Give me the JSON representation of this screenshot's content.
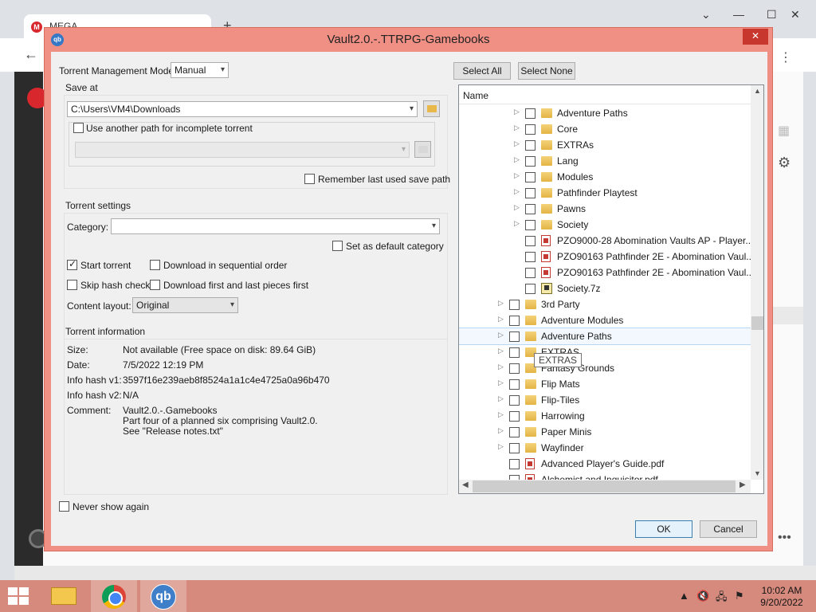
{
  "background": {
    "tab_title": "MEGA",
    "tab_icon_letter": "M"
  },
  "dialog": {
    "title": "Vault2.0.-.TTRPG-Gamebooks",
    "title_icon_text": "qb",
    "close_glyph": "✕",
    "mode_label": "Torrent Management Mode:",
    "mode_value": "Manual",
    "save_at_title": "Save at",
    "save_path": "C:\\Users\\VM4\\Downloads",
    "another_path_label": "Use another path for incomplete torrent",
    "remember_label": "Remember last used save path",
    "settings_title": "Torrent settings",
    "category_label": "Category:",
    "category_value": "",
    "default_category_label": "Set as default category",
    "start_torrent_label": "Start torrent",
    "sequential_label": "Download in sequential order",
    "skip_hash_label": "Skip hash check",
    "first_last_label": "Download first and last pieces first",
    "content_layout_label": "Content layout:",
    "content_layout_value": "Original",
    "info_title": "Torrent information",
    "info": {
      "size_label": "Size:",
      "size_value": "Not available (Free space on disk: 89.64 GiB)",
      "date_label": "Date:",
      "date_value": "7/5/2022 12:19 PM",
      "hash1_label": "Info hash v1:",
      "hash1_value": "3597f16e239aeb8f8524a1a1c4e4725a0a96b470",
      "hash2_label": "Info hash v2:",
      "hash2_value": "N/A",
      "comment_label": "Comment:",
      "comment_line1": "Vault2.0.-.Gamebooks",
      "comment_line2": "Part four of a planned six comprising Vault2.0.",
      "comment_line3": "See \"Release notes.txt\""
    },
    "never_show_label": "Never show again",
    "select_all": "Select All",
    "select_none": "Select None",
    "tree_header": "Name",
    "tree_rows": [
      {
        "label": "Adventure Paths",
        "type": "folder",
        "level": 2,
        "expandable": true
      },
      {
        "label": "Core",
        "type": "folder",
        "level": 2,
        "expandable": true
      },
      {
        "label": "EXTRAs",
        "type": "folder",
        "level": 2,
        "expandable": true
      },
      {
        "label": "Lang",
        "type": "folder",
        "level": 2,
        "expandable": true
      },
      {
        "label": "Modules",
        "type": "folder",
        "level": 2,
        "expandable": true
      },
      {
        "label": "Pathfinder Playtest",
        "type": "folder",
        "level": 2,
        "expandable": true
      },
      {
        "label": "Pawns",
        "type": "folder",
        "level": 2,
        "expandable": true
      },
      {
        "label": "Society",
        "type": "folder",
        "level": 2,
        "expandable": true
      },
      {
        "label": "PZO9000-28 Abomination Vaults AP - Player...",
        "type": "pdf",
        "level": 2,
        "expandable": false
      },
      {
        "label": "PZO90163 Pathfinder 2E - Abomination Vaul...",
        "type": "pdf",
        "level": 2,
        "expandable": false
      },
      {
        "label": "PZO90163 Pathfinder 2E - Abomination Vaul...",
        "type": "pdf",
        "level": 2,
        "expandable": false
      },
      {
        "label": "Society.7z",
        "type": "archive",
        "level": 2,
        "expandable": false
      },
      {
        "label": "3rd Party",
        "type": "folder",
        "level": 1,
        "expandable": true
      },
      {
        "label": "Adventure Modules",
        "type": "folder",
        "level": 1,
        "expandable": true
      },
      {
        "label": "Adventure Paths",
        "type": "folder",
        "level": 1,
        "expandable": true,
        "highlighted": true
      },
      {
        "label": "EXTRAS",
        "type": "folder",
        "level": 1,
        "expandable": true
      },
      {
        "label": "Fantasy Grounds",
        "type": "folder",
        "level": 1,
        "expandable": true
      },
      {
        "label": "Flip Mats",
        "type": "folder",
        "level": 1,
        "expandable": true
      },
      {
        "label": "Flip-Tiles",
        "type": "folder",
        "level": 1,
        "expandable": true
      },
      {
        "label": "Harrowing",
        "type": "folder",
        "level": 1,
        "expandable": true
      },
      {
        "label": "Paper Minis",
        "type": "folder",
        "level": 1,
        "expandable": true
      },
      {
        "label": "Wayfinder",
        "type": "folder",
        "level": 1,
        "expandable": true
      },
      {
        "label": "Advanced Player's Guide.pdf",
        "type": "pdf",
        "level": 1,
        "expandable": false
      },
      {
        "label": "Alchemist and Inquisitor.pdf",
        "type": "pdf",
        "level": 1,
        "expandable": false
      }
    ],
    "tooltip": "EXTRAS",
    "ok": "OK",
    "cancel": "Cancel"
  },
  "taskbar": {
    "qb_text": "qb",
    "time": "10:02 AM",
    "date": "9/20/2022"
  }
}
